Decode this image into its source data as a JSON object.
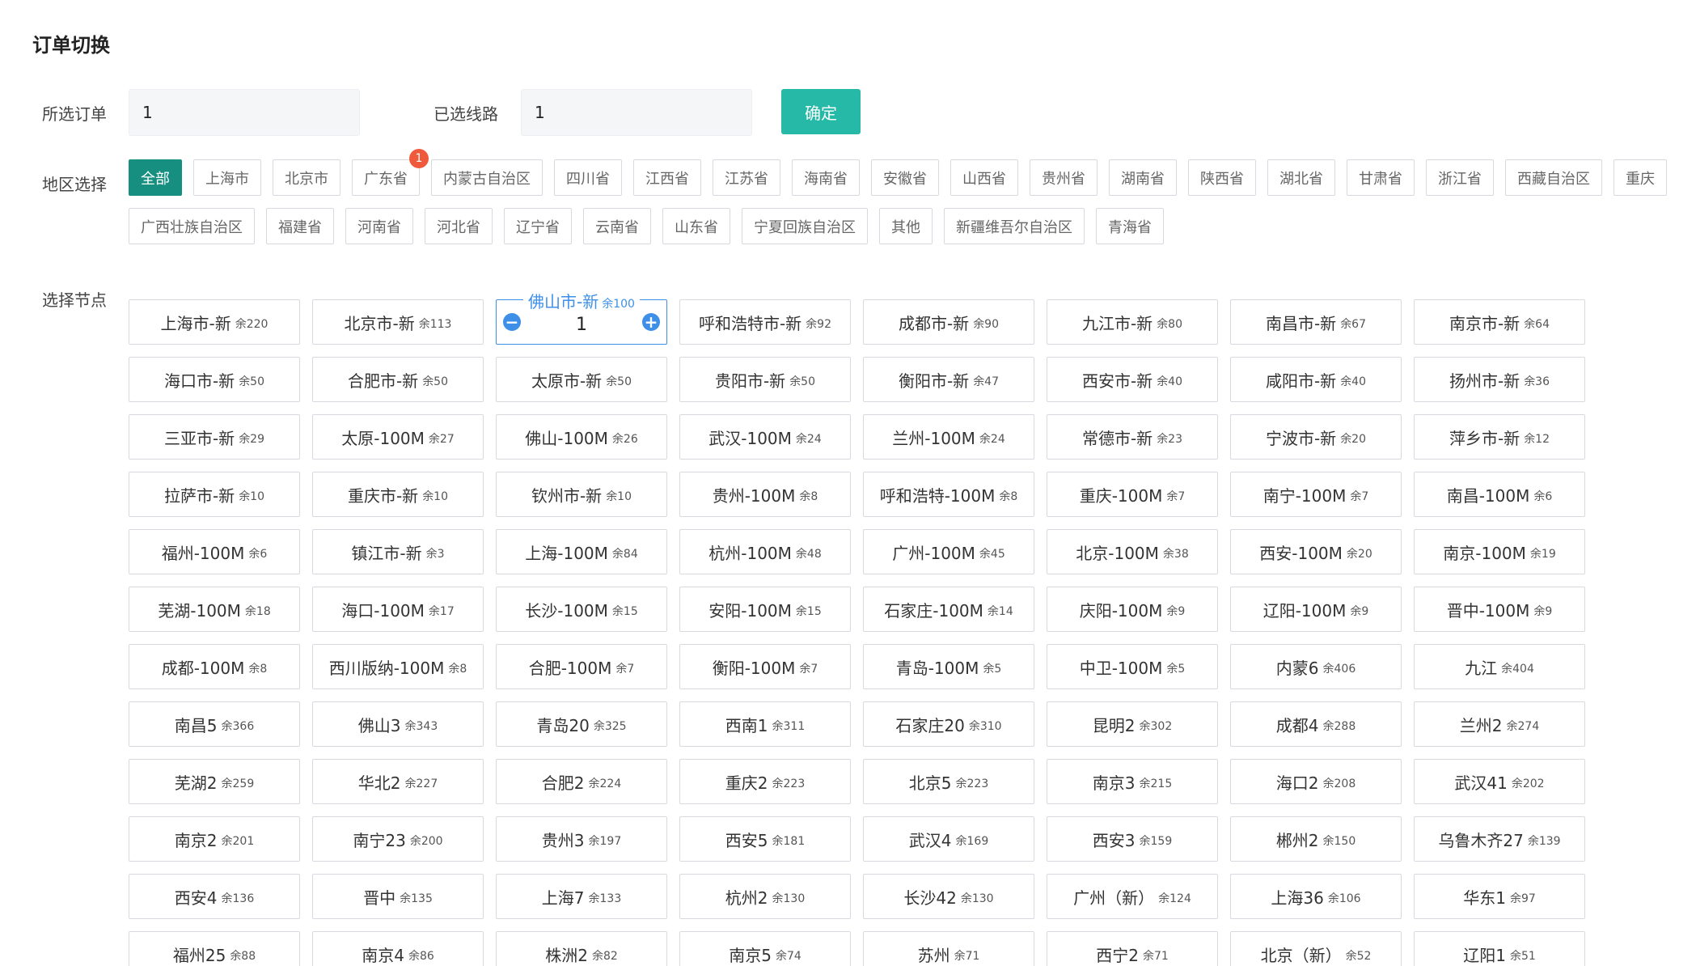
{
  "title": "订单切换",
  "order": {
    "label": "所选订单",
    "value": "1"
  },
  "line": {
    "label": "已选线路",
    "value": "1"
  },
  "confirm_label": "确定",
  "region": {
    "label": "地区选择",
    "row1": [
      "全部",
      "上海市",
      "北京市",
      "广东省",
      "内蒙古自治区",
      "四川省",
      "江西省",
      "江苏省",
      "海南省",
      "安徽省",
      "山西省",
      "贵州省",
      "湖南省",
      "陕西省",
      "湖北省",
      "甘肃省",
      "浙江省",
      "西藏自治区",
      "重庆"
    ],
    "row2": [
      "广西壮族自治区",
      "福建省",
      "河南省",
      "河北省",
      "辽宁省",
      "云南省",
      "山东省",
      "宁夏回族自治区",
      "其他",
      "新疆维吾尔自治区",
      "青海省"
    ],
    "badge_on": "广东省",
    "badge_count": "1"
  },
  "nodes_label": "选择节点",
  "selected_node": {
    "name": "佛山市-新",
    "remaining": "余100",
    "quantity": "1",
    "minus_glyph": "−",
    "plus_glyph": "+"
  },
  "nodes": [
    {
      "name": "上海市-新",
      "rem": "余220"
    },
    {
      "name": "北京市-新",
      "rem": "余113"
    },
    {
      "name": "佛山市-新",
      "rem": "余100",
      "selected": true
    },
    {
      "name": "呼和浩特市-新",
      "rem": "余92"
    },
    {
      "name": "成都市-新",
      "rem": "余90"
    },
    {
      "name": "九江市-新",
      "rem": "余80"
    },
    {
      "name": "南昌市-新",
      "rem": "余67"
    },
    {
      "name": "南京市-新",
      "rem": "余64"
    },
    {
      "name": "海口市-新",
      "rem": "余50"
    },
    {
      "name": "合肥市-新",
      "rem": "余50"
    },
    {
      "name": "太原市-新",
      "rem": "余50"
    },
    {
      "name": "贵阳市-新",
      "rem": "余50"
    },
    {
      "name": "衡阳市-新",
      "rem": "余47"
    },
    {
      "name": "西安市-新",
      "rem": "余40"
    },
    {
      "name": "咸阳市-新",
      "rem": "余40"
    },
    {
      "name": "扬州市-新",
      "rem": "余36"
    },
    {
      "name": "三亚市-新",
      "rem": "余29"
    },
    {
      "name": "太原-100M",
      "rem": "余27"
    },
    {
      "name": "佛山-100M",
      "rem": "余26"
    },
    {
      "name": "武汉-100M",
      "rem": "余24"
    },
    {
      "name": "兰州-100M",
      "rem": "余24"
    },
    {
      "name": "常德市-新",
      "rem": "余23"
    },
    {
      "name": "宁波市-新",
      "rem": "余20"
    },
    {
      "name": "萍乡市-新",
      "rem": "余12"
    },
    {
      "name": "拉萨市-新",
      "rem": "余10"
    },
    {
      "name": "重庆市-新",
      "rem": "余10"
    },
    {
      "name": "钦州市-新",
      "rem": "余10"
    },
    {
      "name": "贵州-100M",
      "rem": "余8"
    },
    {
      "name": "呼和浩特-100M",
      "rem": "余8"
    },
    {
      "name": "重庆-100M",
      "rem": "余7"
    },
    {
      "name": "南宁-100M",
      "rem": "余7"
    },
    {
      "name": "南昌-100M",
      "rem": "余6"
    },
    {
      "name": "福州-100M",
      "rem": "余6"
    },
    {
      "name": "镇江市-新",
      "rem": "余3"
    },
    {
      "name": "上海-100M",
      "rem": "余84"
    },
    {
      "name": "杭州-100M",
      "rem": "余48"
    },
    {
      "name": "广州-100M",
      "rem": "余45"
    },
    {
      "name": "北京-100M",
      "rem": "余38"
    },
    {
      "name": "西安-100M",
      "rem": "余20"
    },
    {
      "name": "南京-100M",
      "rem": "余19"
    },
    {
      "name": "芜湖-100M",
      "rem": "余18"
    },
    {
      "name": "海口-100M",
      "rem": "余17"
    },
    {
      "name": "长沙-100M",
      "rem": "余15"
    },
    {
      "name": "安阳-100M",
      "rem": "余15"
    },
    {
      "name": "石家庄-100M",
      "rem": "余14"
    },
    {
      "name": "庆阳-100M",
      "rem": "余9"
    },
    {
      "name": "辽阳-100M",
      "rem": "余9"
    },
    {
      "name": "晋中-100M",
      "rem": "余9"
    },
    {
      "name": "成都-100M",
      "rem": "余8"
    },
    {
      "name": "西川版纳-100M",
      "rem": "余8"
    },
    {
      "name": "合肥-100M",
      "rem": "余7"
    },
    {
      "name": "衡阳-100M",
      "rem": "余7"
    },
    {
      "name": "青岛-100M",
      "rem": "余5"
    },
    {
      "name": "中卫-100M",
      "rem": "余5"
    },
    {
      "name": "内蒙6",
      "rem": "余406"
    },
    {
      "name": "九江",
      "rem": "余404"
    },
    {
      "name": "南昌5",
      "rem": "余366"
    },
    {
      "name": "佛山3",
      "rem": "余343"
    },
    {
      "name": "青岛20",
      "rem": "余325"
    },
    {
      "name": "西南1",
      "rem": "余311"
    },
    {
      "name": "石家庄20",
      "rem": "余310"
    },
    {
      "name": "昆明2",
      "rem": "余302"
    },
    {
      "name": "成都4",
      "rem": "余288"
    },
    {
      "name": "兰州2",
      "rem": "余274"
    },
    {
      "name": "芜湖2",
      "rem": "余259"
    },
    {
      "name": "华北2",
      "rem": "余227"
    },
    {
      "name": "合肥2",
      "rem": "余224"
    },
    {
      "name": "重庆2",
      "rem": "余223"
    },
    {
      "name": "北京5",
      "rem": "余223"
    },
    {
      "name": "南京3",
      "rem": "余215"
    },
    {
      "name": "海口2",
      "rem": "余208"
    },
    {
      "name": "武汉41",
      "rem": "余202"
    },
    {
      "name": "南京2",
      "rem": "余201"
    },
    {
      "name": "南宁23",
      "rem": "余200"
    },
    {
      "name": "贵州3",
      "rem": "余197"
    },
    {
      "name": "西安5",
      "rem": "余181"
    },
    {
      "name": "武汉4",
      "rem": "余169"
    },
    {
      "name": "西安3",
      "rem": "余159"
    },
    {
      "name": "郴州2",
      "rem": "余150"
    },
    {
      "name": "乌鲁木齐27",
      "rem": "余139"
    },
    {
      "name": "西安4",
      "rem": "余136"
    },
    {
      "name": "晋中",
      "rem": "余135"
    },
    {
      "name": "上海7",
      "rem": "余133"
    },
    {
      "name": "杭州2",
      "rem": "余130"
    },
    {
      "name": "长沙42",
      "rem": "余130"
    },
    {
      "name": "广州（新）",
      "rem": "余124"
    },
    {
      "name": "上海36",
      "rem": "余106"
    },
    {
      "name": "华东1",
      "rem": "余97"
    },
    {
      "name": "福州25",
      "rem": "余88"
    },
    {
      "name": "南京4",
      "rem": "余86"
    },
    {
      "name": "株洲2",
      "rem": "余82"
    },
    {
      "name": "南京5",
      "rem": "余74"
    },
    {
      "name": "苏州",
      "rem": "余71"
    },
    {
      "name": "西宁2",
      "rem": "余71"
    },
    {
      "name": "北京（新）",
      "rem": "余52"
    },
    {
      "name": "辽阳1",
      "rem": "余51"
    }
  ]
}
